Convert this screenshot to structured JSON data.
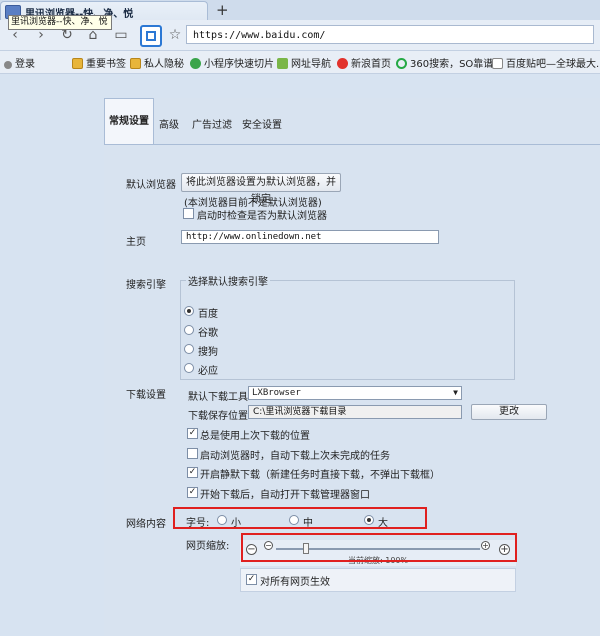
{
  "window": {
    "tab_title": "里讯浏览器--快、净、悦",
    "tooltip": "里讯浏览器--快、净、悦",
    "new_tab": "+"
  },
  "toolbar": {
    "back_icon": "‹",
    "forward_icon": "›",
    "refresh_icon": "↻",
    "home_icon": "⌂",
    "reader_icon": "▭",
    "star_icon": "☆",
    "url": "https://www.baidu.com/"
  },
  "bookmarks": [
    {
      "label": "登录",
      "icon": "user-icon"
    },
    {
      "label": "重要书签",
      "icon": "folder-icon"
    },
    {
      "label": "私人隐秘",
      "icon": "folder-icon"
    },
    {
      "label": "小程序快速切片",
      "icon": "globe-icon"
    },
    {
      "label": "网址导航",
      "icon": "check-icon"
    },
    {
      "label": "新浪首页",
      "icon": "weibo-icon"
    },
    {
      "label": "360搜索，SO靠谱",
      "icon": "360-icon"
    },
    {
      "label": "百度贴吧—全球最大...",
      "icon": "page-icon"
    }
  ],
  "tabs": [
    "常规设置",
    "高级",
    "广告过滤",
    "安全设置"
  ],
  "default_browser": {
    "label": "默认浏览器",
    "button": "将此浏览器设置为默认浏览器，并锁定",
    "status": "(本浏览器目前不是默认浏览器)",
    "check_startup": "启动时检查是否为默认浏览器"
  },
  "homepage": {
    "label": "主页",
    "value": "http://www.onlinedown.net"
  },
  "search": {
    "label": "搜索引擎",
    "group_title": "选择默认搜索引擎",
    "options": [
      "百度",
      "谷歌",
      "搜狗",
      "必应"
    ],
    "selected": "百度"
  },
  "download": {
    "label": "下载设置",
    "tool_label": "默认下载工具",
    "tool_value": "LXBrowser",
    "path_label": "下载保存位置",
    "path_value": "C:\\里讯浏览器下载目录",
    "change_button": "更改",
    "opt1": "总是使用上次下载的位置",
    "opt2": "启动浏览器时，自动下载上次未完成的任务",
    "opt3": "开启静默下载（新建任务时直接下载，不弹出下载框）",
    "opt4": "开始下载后，自动打开下载管理器窗口"
  },
  "web_content": {
    "label": "网络内容",
    "font_label": "字号:",
    "font_options": [
      "小",
      "中",
      "大"
    ],
    "font_selected": "大",
    "zoom_label": "网页缩放:",
    "zoom_text": "当前缩放: 100%",
    "zoom_percent": 100,
    "apply_all": "对所有网页生效"
  },
  "colors": {
    "accent": "#2c78d4",
    "highlight_border": "#e0201f"
  }
}
